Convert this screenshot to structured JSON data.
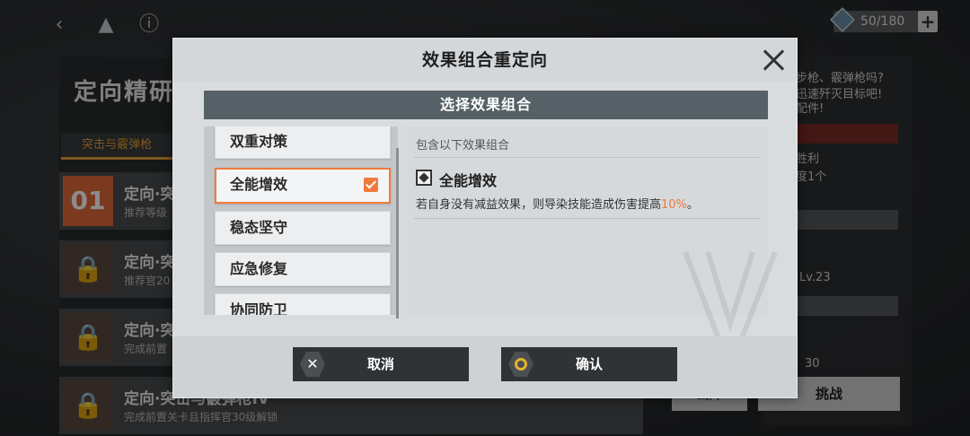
{
  "top_bar": {
    "currency_value": "50/180",
    "icons": [
      "back-icon",
      "drive-icon",
      "info-icon"
    ]
  },
  "background": {
    "title": "定向精研",
    "tab_label": "突击与霰弹枪",
    "items": [
      {
        "number": "01",
        "name": "定向·突",
        "sub": "推荐等级"
      },
      {
        "number": "",
        "name": "定向·突",
        "sub": "推荐官20"
      },
      {
        "number": "",
        "name": "定向·突",
        "sub": "完成前置"
      },
      {
        "number": "",
        "name": "定向·突击与霰弹枪IV",
        "sub": "完成前置关卡且指挥官30级解锁"
      }
    ],
    "right_text_1": "步枪、霰弹枪吗?",
    "right_text_2": "迅速歼灭目标吧!",
    "right_text_3": "配件!",
    "right_text_4": "胜利",
    "right_text_5": "度1个",
    "right_level": "Lv.23",
    "right_value": "30",
    "right_btn_left": "出库",
    "right_btn_right": "挑战"
  },
  "modal": {
    "title": "效果组合重定向",
    "section_title": "选择效果组合",
    "options": [
      {
        "label": "双重对策",
        "selected": false
      },
      {
        "label": "全能增效",
        "selected": true
      },
      {
        "label": "稳态坚守",
        "selected": false
      },
      {
        "label": "应急修复",
        "selected": false
      },
      {
        "label": "协同防卫",
        "selected": false
      }
    ],
    "detail_caption": "包含以下效果组合",
    "effect_name": "全能增效",
    "effect_desc_before": "若自身没有减益效果，则导染技能造成伤害提高",
    "effect_desc_value": "10%",
    "effect_desc_after": "。",
    "cancel_label": "取消",
    "confirm_label": "确认"
  },
  "colors": {
    "accent": "#ef7a3c",
    "section_bar": "#556166",
    "button_dark": "#2f3336",
    "confirm_ring": "#e3b22e"
  }
}
